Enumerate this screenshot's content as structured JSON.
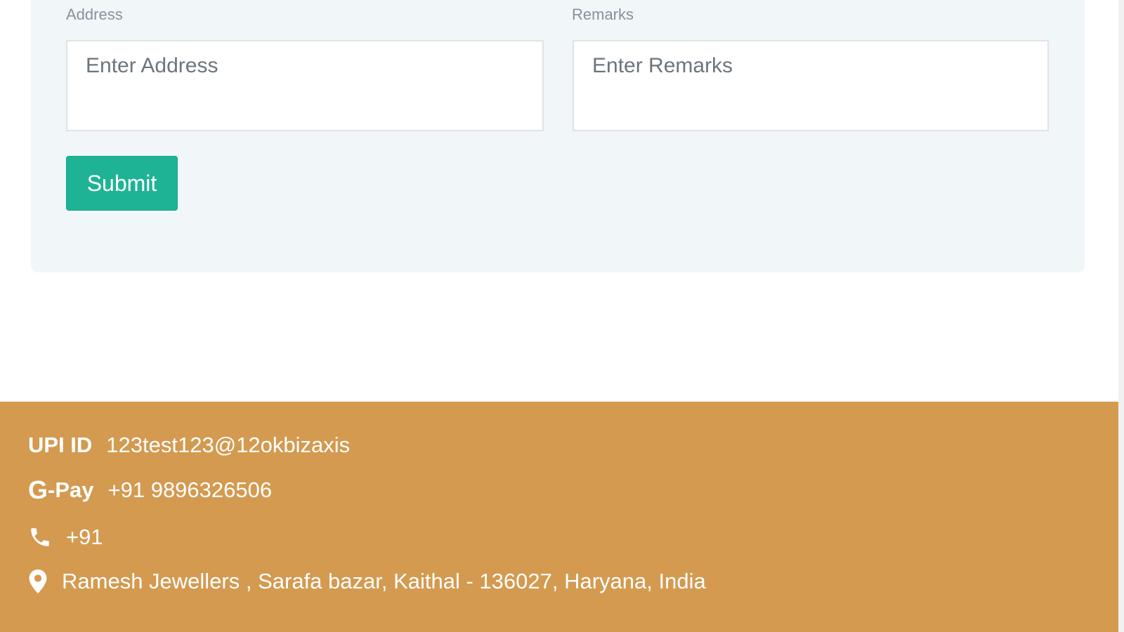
{
  "form": {
    "address_label": "Address",
    "address_placeholder": "Enter Address",
    "remarks_label": "Remarks",
    "remarks_placeholder": "Enter Remarks",
    "submit_label": "Submit"
  },
  "footer": {
    "upi_label": "UPI ID",
    "upi_value": "123test123@12okbizaxis",
    "gpay_g": "G",
    "gpay_label": "-Pay",
    "gpay_value": "+91 9896326506",
    "phone_icon": "phone-icon",
    "phone_value": "+91",
    "location_icon": "map-pin-icon",
    "address_value": "Ramesh Jewellers , Sarafa bazar, Kaithal - 136027, Haryana, India"
  },
  "colors": {
    "card_background": "#f1f6f9",
    "submit_button": "#1fb396",
    "footer_background": "#d39a50",
    "footer_text": "#ffffff"
  }
}
